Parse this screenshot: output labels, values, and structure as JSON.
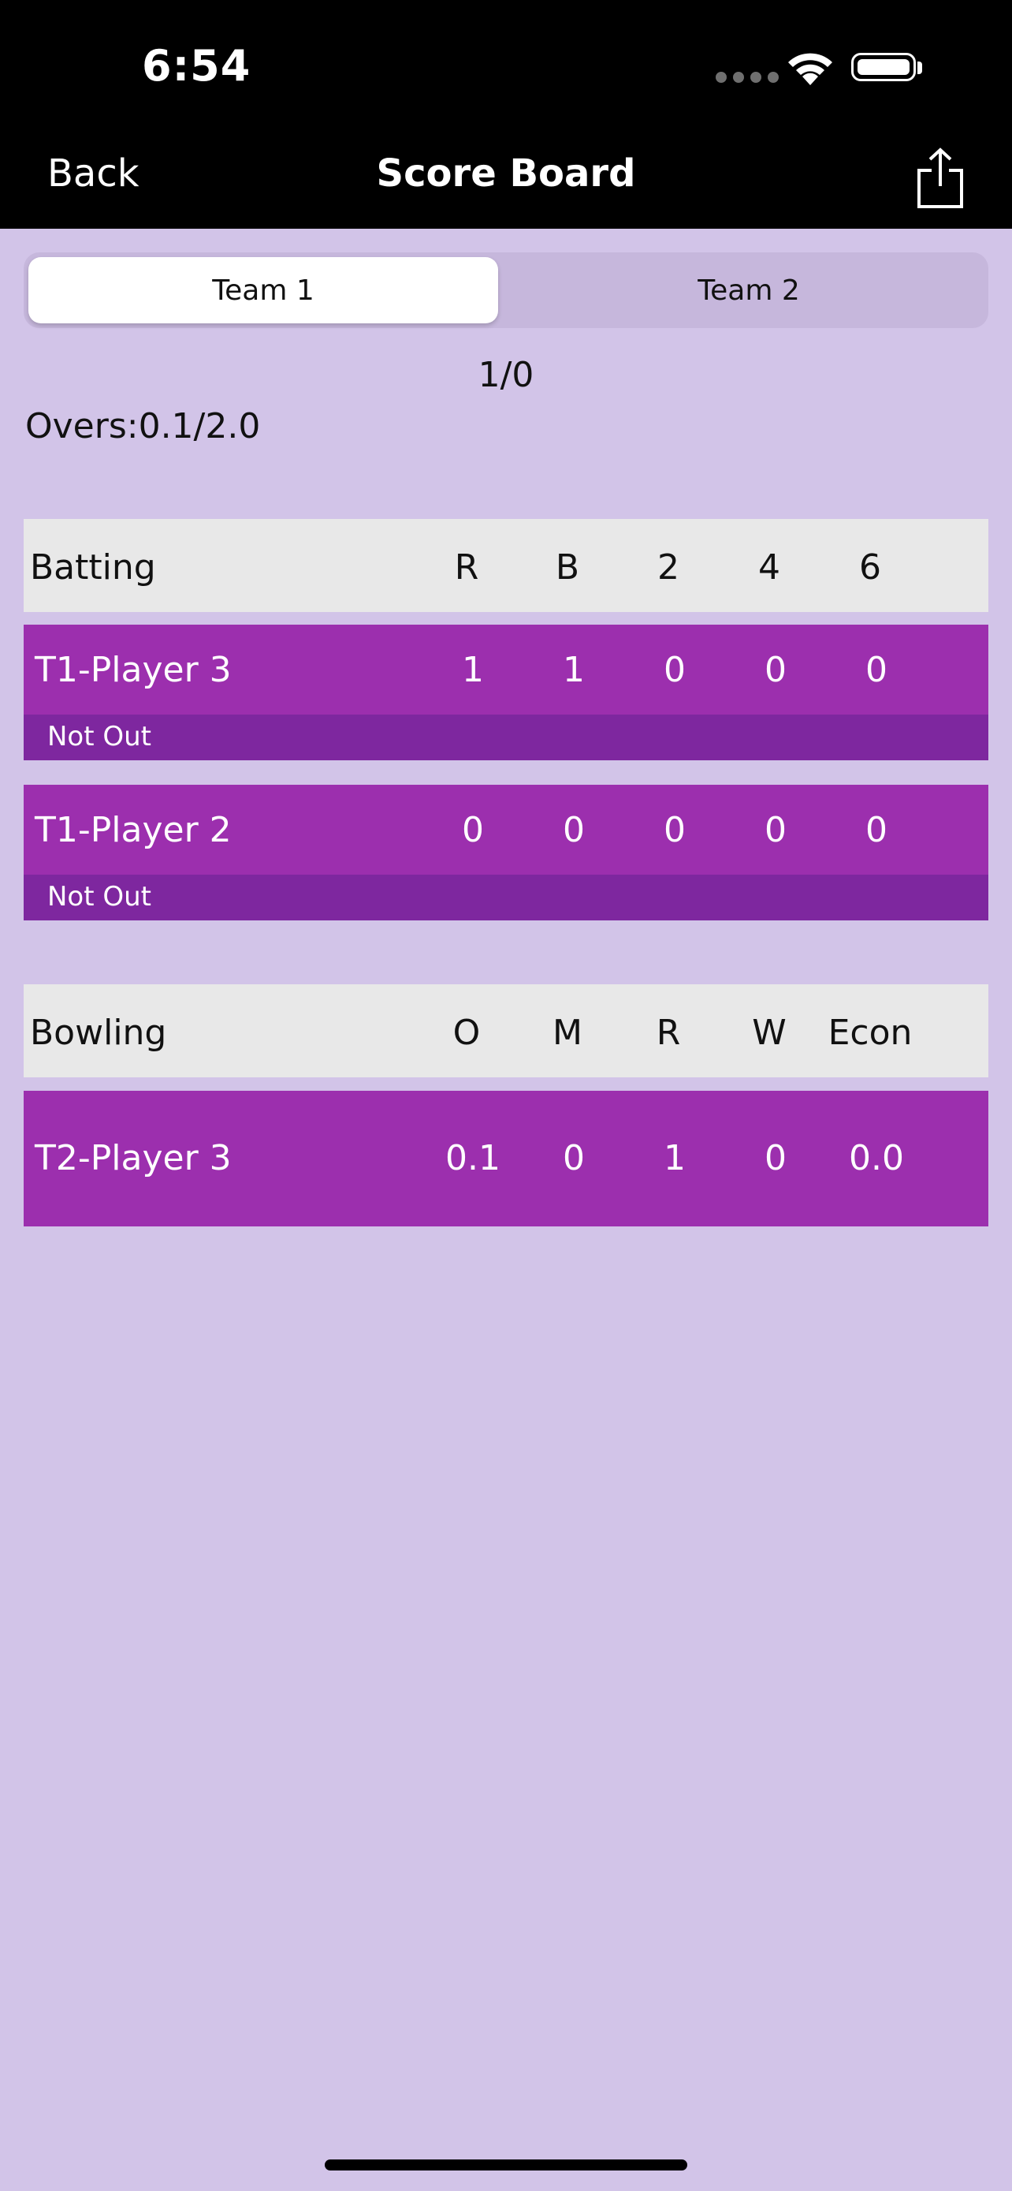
{
  "status_bar": {
    "time": "6:54"
  },
  "nav": {
    "back_label": "Back",
    "title": "Score Board",
    "share_icon": "share-icon"
  },
  "tabs": [
    {
      "label": "Team 1",
      "selected": true
    },
    {
      "label": "Team 2",
      "selected": false
    }
  ],
  "score": "1/0",
  "overs": "Overs:0.1/2.0",
  "batting": {
    "header": {
      "label": "Batting",
      "columns": [
        "R",
        "B",
        "2",
        "4",
        "6"
      ]
    },
    "rows": [
      {
        "name": "T1-Player 3",
        "values": [
          "1",
          "1",
          "0",
          "0",
          "0"
        ],
        "status": "Not Out"
      },
      {
        "name": "T1-Player 2",
        "values": [
          "0",
          "0",
          "0",
          "0",
          "0"
        ],
        "status": "Not Out"
      }
    ]
  },
  "bowling": {
    "header": {
      "label": "Bowling",
      "columns": [
        "O",
        "M",
        "R",
        "W",
        "Econ"
      ]
    },
    "rows": [
      {
        "name": "T2-Player 3",
        "values": [
          "0.1",
          "0",
          "1",
          "0",
          "0.0"
        ]
      }
    ]
  },
  "colors": {
    "background": "#d2c4e8",
    "row_primary": "#9c2fae",
    "row_status": "#7e279f",
    "header_row": "#e8e8e8"
  }
}
